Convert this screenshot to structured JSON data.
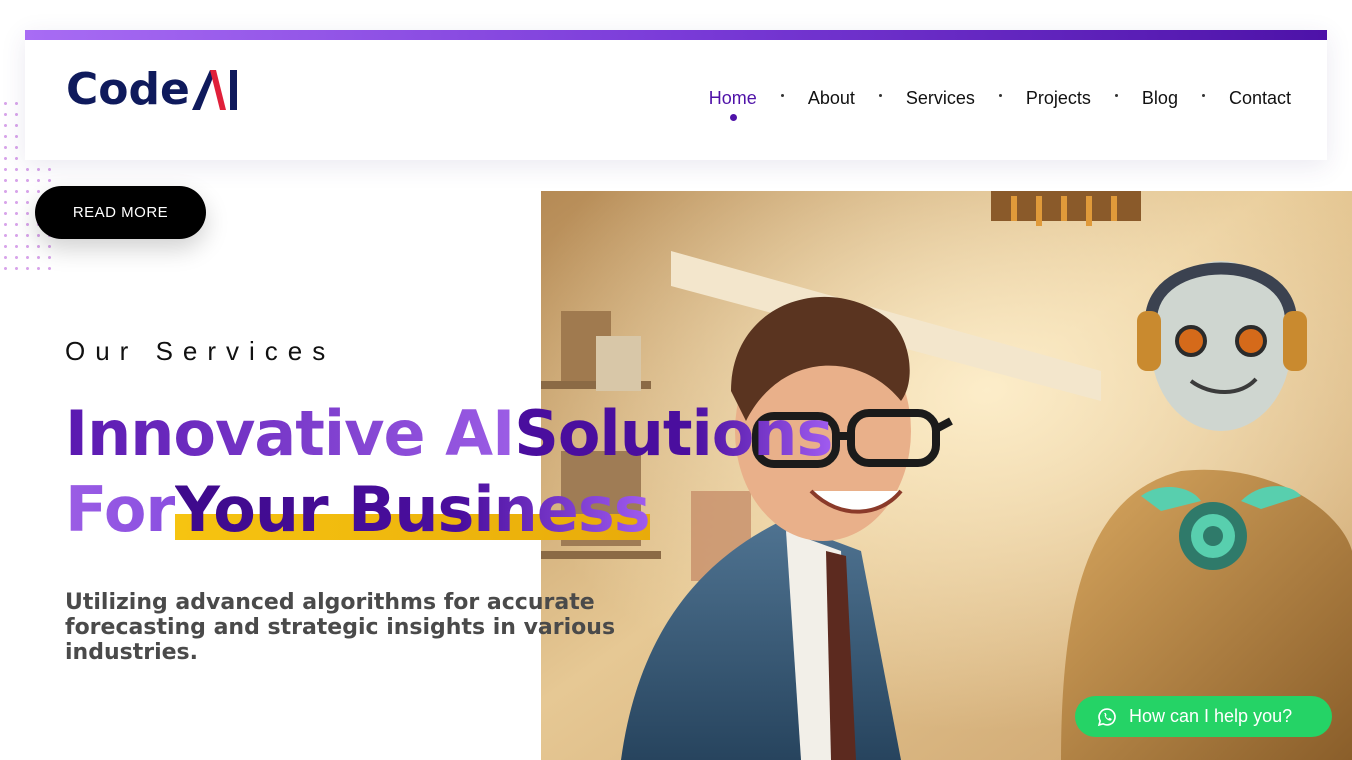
{
  "brand": {
    "logo_text": "Code",
    "logo_accent": "Ai"
  },
  "nav": {
    "items": [
      {
        "label": "Home",
        "active": true
      },
      {
        "label": "About",
        "active": false
      },
      {
        "label": "Services",
        "active": false
      },
      {
        "label": "Projects",
        "active": false
      },
      {
        "label": "Blog",
        "active": false
      },
      {
        "label": "Contact",
        "active": false
      }
    ]
  },
  "cta": {
    "read_more": "READ MORE"
  },
  "hero": {
    "eyebrow": "Our Services",
    "headline_part1": "Innovative AI",
    "headline_part2": "Solutions",
    "headline_part3": "For",
    "headline_part4": "Your Business",
    "description": "Utilizing advanced algorithms for accurate forecasting and strategic insights in various industries."
  },
  "chat": {
    "label": "How can I help you?"
  },
  "colors": {
    "accent": "#4f12a8",
    "highlight": "#f6c411",
    "chat": "#25d366",
    "logo": "#0f1a5c",
    "logo_mark": "#e0203a"
  },
  "icons": {
    "chat_icon": "whatsapp-icon"
  }
}
